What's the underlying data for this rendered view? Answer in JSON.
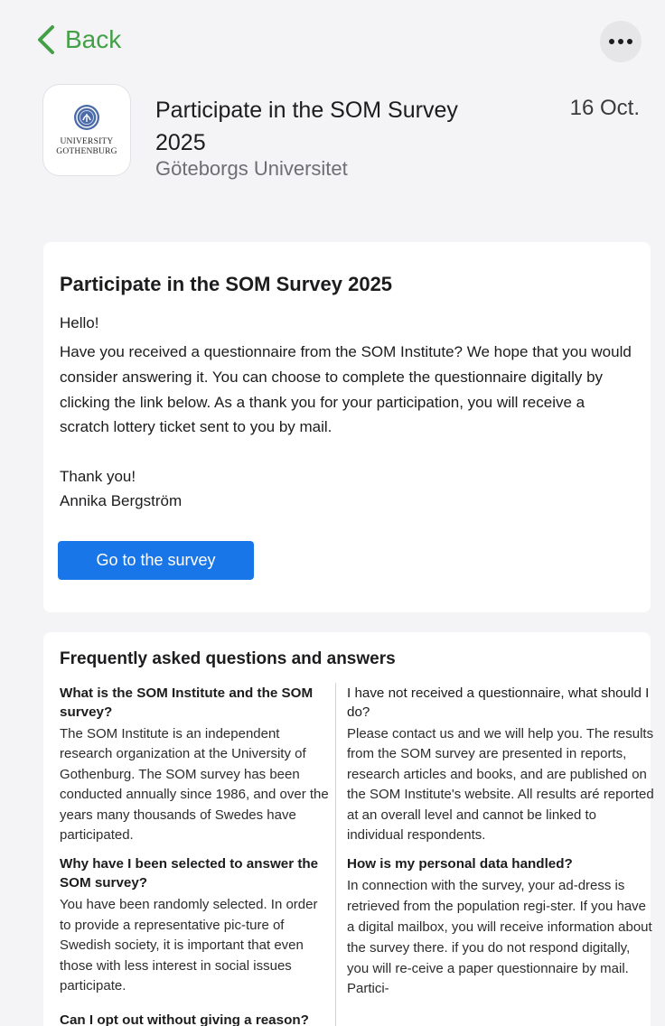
{
  "nav": {
    "back_label": "Back"
  },
  "message": {
    "title": "Participate in the SOM Survey 2025",
    "sender": "Göteborgs Universitet",
    "date": "16 Oct.",
    "logo_text_1": "UNIVERSITY",
    "logo_text_2": "GOTHENBURG"
  },
  "letter": {
    "heading": "Participate in the SOM Survey 2025",
    "greeting": "Hello!",
    "body": "Have you received a questionnaire from the SOM Institute? We hope that you would consider answering it. You can choose to complete the questionnaire digitally by clicking the link below. As a thank you for your participation, you will receive a scratch lottery ticket sent to you by mail.",
    "thanks": "Thank you!",
    "signature": "Annika Bergström",
    "button_label": "Go to the survey"
  },
  "faq": {
    "heading": "Frequently asked questions and answers",
    "left": [
      {
        "q": "What is the SOM Institute and the SOM survey?",
        "a": "The SOM Institute is an independent research organization at the University of Gothenburg. The SOM survey has been conducted annually since 1986, and over the years many thousands of Swedes have participated."
      },
      {
        "q": "Why have I been selected to answer the SOM survey?",
        "a": "You have been randomly selected. In order to provide a representative pic-ture of Swedish society, it is important that even those with less interest in social issues participate."
      },
      {
        "q": "Can I opt out without giving a reason?",
        "a": ""
      }
    ],
    "right": [
      {
        "q": "I have not received a questionnaire, what should I do?",
        "a": "Please contact us and we will help you. The results from the SOM survey are presented in reports, research articles and books, and are published on the SOM Institute's website. All results aré reported at an overall level and cannot be linked to individual respondents."
      },
      {
        "q": "How is my personal data handled?",
        "a": "In connection with the survey, your ad-dress is retrieved from the population regi-ster. If you have a digital mailbox, you will receive information about the survey there. if you do not respond digitally, you will re-ceive a paper questionnaire by mail. Partici-"
      }
    ]
  }
}
